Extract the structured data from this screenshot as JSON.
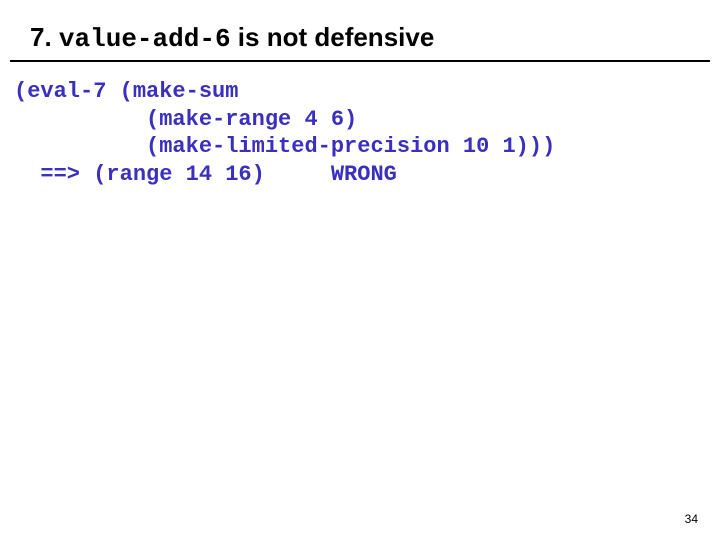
{
  "title": {
    "number": "7.",
    "code": "value-add-6",
    "rest": "is not defensive"
  },
  "code": {
    "l1": "(eval-7 (make-sum",
    "l2": "          (make-range 4 6)",
    "l3": "          (make-limited-precision 10 1)))",
    "l4": "  ==> (range 14 16)     WRONG"
  },
  "page": "34"
}
